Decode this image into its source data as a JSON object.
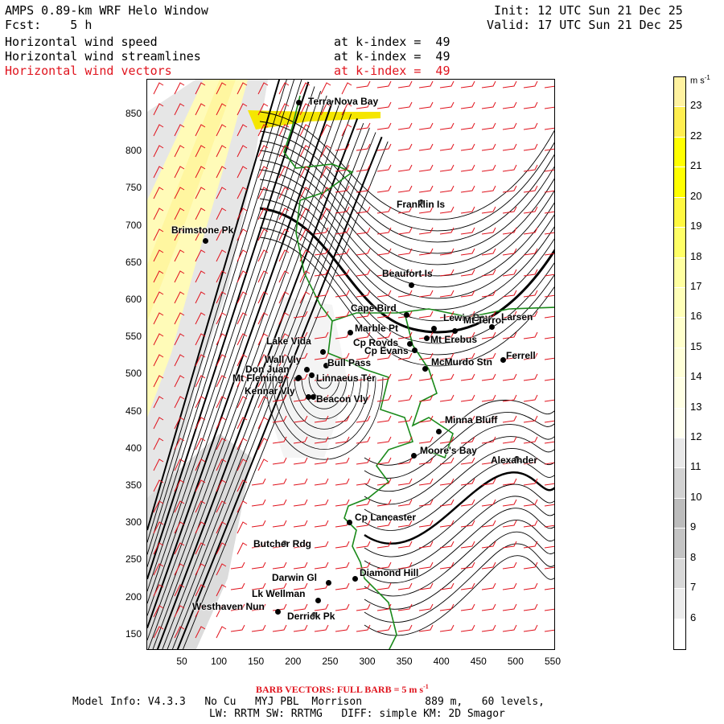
{
  "header": {
    "model_title": "AMPS 0.89-km WRF Helo Window",
    "init": "Init: 12 UTC Sun 21 Dec 25",
    "fcst": "Fcst:    5 h",
    "valid": "Valid: 17 UTC Sun 21 Dec 25",
    "fields": [
      {
        "name": "Horizontal wind speed",
        "level": "at k-index =  49",
        "color": "#000000"
      },
      {
        "name": "Horizontal wind streamlines",
        "level": "at k-index =  49",
        "color": "#000000"
      },
      {
        "name": "Horizontal wind vectors",
        "level": "at k-index =  49",
        "color": "#e0141e"
      }
    ]
  },
  "map": {
    "y_ticks": [
      "850",
      "800",
      "750",
      "700",
      "650",
      "600",
      "550",
      "500",
      "450",
      "400",
      "350",
      "300",
      "250",
      "200",
      "150"
    ],
    "x_ticks": [
      "50",
      "100",
      "150",
      "200",
      "250",
      "300",
      "350",
      "400",
      "450",
      "500",
      "550"
    ],
    "places": [
      {
        "name": "Terra Nova Bay"
      },
      {
        "name": "Franklin Is"
      },
      {
        "name": "Brimstone Pk"
      },
      {
        "name": "Beaufort Is"
      },
      {
        "name": "Cape Bird"
      },
      {
        "name": "Lewis Bay"
      },
      {
        "name": "Mt Terror"
      },
      {
        "name": "Larsen"
      },
      {
        "name": "Marble Pt"
      },
      {
        "name": "Lake Vida"
      },
      {
        "name": "Cp Royds"
      },
      {
        "name": "Mt Erebus"
      },
      {
        "name": "Cp Evans"
      },
      {
        "name": "Bull Pass"
      },
      {
        "name": "Wall Vly"
      },
      {
        "name": "Don Juan"
      },
      {
        "name": "McMurdo Stn"
      },
      {
        "name": "Ferrell"
      },
      {
        "name": "Mt Fleming"
      },
      {
        "name": "Linnaeus Ter"
      },
      {
        "name": "Kennar Vly"
      },
      {
        "name": "Beacon Vly"
      },
      {
        "name": "Minna Bluff"
      },
      {
        "name": "Moore's Bay"
      },
      {
        "name": "Alexander"
      },
      {
        "name": "Cp Lancaster"
      },
      {
        "name": "Butcher Rdg"
      },
      {
        "name": "Darwin Gl"
      },
      {
        "name": "Diamond Hill"
      },
      {
        "name": "Lk Wellman"
      },
      {
        "name": "Westhaven Nun"
      },
      {
        "name": "Derrick Pk"
      }
    ]
  },
  "colorbar": {
    "units": "m s",
    "units_sup": "-1",
    "levels": [
      "23",
      "22",
      "21",
      "20",
      "19",
      "18",
      "17",
      "16",
      "15",
      "14",
      "13",
      "12",
      "11",
      "10",
      "9",
      "8",
      "7",
      "6"
    ],
    "colors": [
      "#fff2a0",
      "#ffee50",
      "#ffff00",
      "#ffff00",
      "#fff840",
      "#ffff66",
      "#ffffa0",
      "#ffffb8",
      "#ffffcc",
      "#ffffd8",
      "#ffffe4",
      "#fffff0",
      "#e8e8e8",
      "#d2d2d2",
      "#bcbcbc",
      "#c4c4c4",
      "#d8d8d8",
      "#ececec",
      "#ffffff"
    ]
  },
  "footer": {
    "barb_note": "BARB VECTORS:  FULL BARB = 5 m s",
    "barb_sup": "-1",
    "model_info": "Model Info: V4.3.3   No Cu   MYJ PBL  Morrison          889 m,   60 levels,",
    "physics": "LW: RRTM SW: RRTMG   DIFF: simple KM: 2D Smagor"
  }
}
